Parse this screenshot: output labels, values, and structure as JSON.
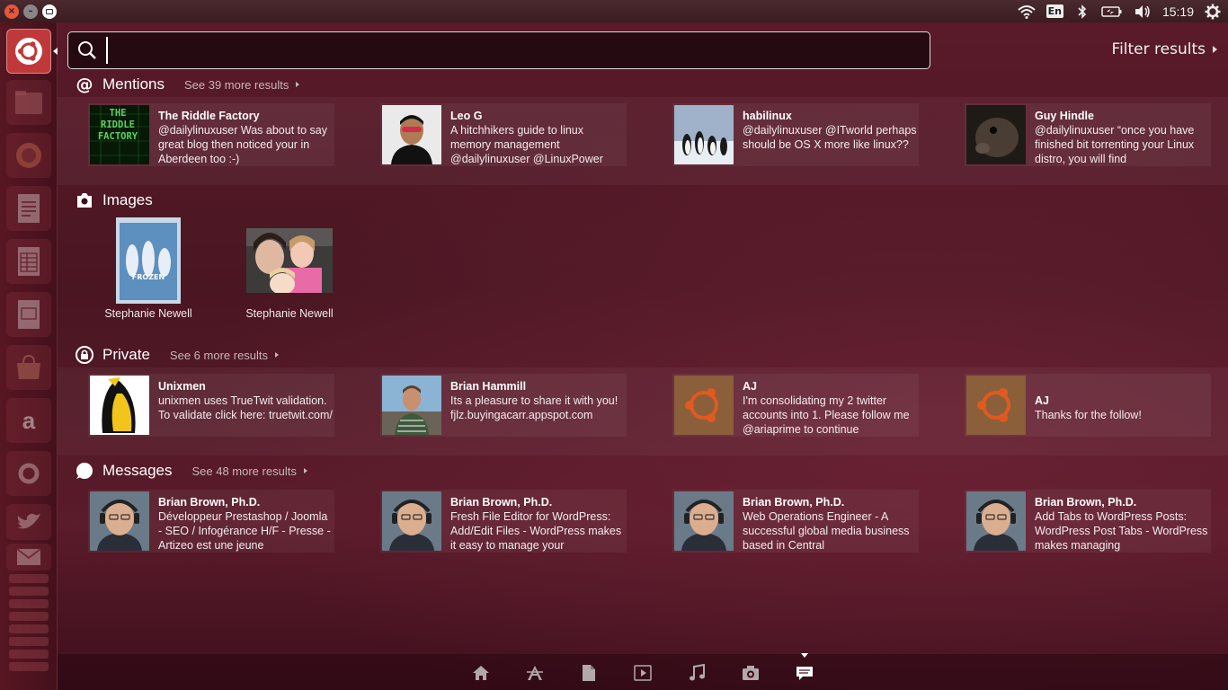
{
  "top_panel": {
    "keyboard_layout": "En",
    "clock": "15:19",
    "icons": [
      "close-icon",
      "minimize-icon",
      "maximize-icon",
      "wifi-icon",
      "bluetooth-icon",
      "battery-icon",
      "volume-icon",
      "gear-icon"
    ]
  },
  "search": {
    "value": "",
    "placeholder": ""
  },
  "filter": {
    "label": "Filter results"
  },
  "categories": {
    "mentions": {
      "title": "Mentions",
      "see_more": "See 39 more results",
      "results": [
        {
          "title": "The Riddle Factory",
          "text": "@dailylinuxuser Was about to say great blog then noticed your in Aberdeen too :-)",
          "thumb_text": "THE RIDDLE FACTORY"
        },
        {
          "title": "Leo G",
          "text": "A hitchhikers guide to linux memory management @dailylinuxuser @LinuxPower"
        },
        {
          "title": "habilinux",
          "text": "@dailylinuxuser @ITworld perhaps should be OS X more like linux??"
        },
        {
          "title": "Guy Hindle",
          "text": "@dailylinuxuser “once you have finished bit torrenting your Linux distro, you will find"
        }
      ]
    },
    "images": {
      "title": "Images",
      "results": [
        {
          "caption": "Stephanie Newell",
          "thumb_text": "FROZEN"
        },
        {
          "caption": "Stephanie Newell"
        }
      ]
    },
    "private": {
      "title": "Private",
      "see_more": "See 6 more results",
      "results": [
        {
          "title": "Unixmen",
          "text": "unixmen uses TrueTwit validation. To validate click here: truetwit.com/"
        },
        {
          "title": "Brian Hammill",
          "text": "Its a pleasure to share it with you! fjlz.buyingacarr.appspot.com"
        },
        {
          "title": "AJ",
          "text": "I'm consolidating my 2 twitter accounts into 1.  Please follow me @ariaprime to continue"
        },
        {
          "title": "AJ",
          "text": "Thanks for the follow!"
        }
      ]
    },
    "messages": {
      "title": "Messages",
      "see_more": "See 48 more results",
      "results": [
        {
          "title": "Brian Brown, Ph.D.",
          "text": "Développeur Prestashop / Joomla - SEO / Infogérance H/F - Presse - Artizeo est une jeune"
        },
        {
          "title": "Brian Brown, Ph.D.",
          "text": "Fresh File Editor for WordPress: Add/Edit Files -  WordPress makes it easy to manage your"
        },
        {
          "title": "Brian Brown, Ph.D.",
          "text": "Web Operations Engineer - A successful global media business based in Central"
        },
        {
          "title": "Brian Brown, Ph.D.",
          "text": "Add Tabs to WordPress Posts: WordPress Post Tabs - WordPress makes managing"
        }
      ]
    }
  },
  "launcher": {
    "items": [
      "ubuntu-dash-icon",
      "files-icon",
      "firefox-icon",
      "writer-icon",
      "calc-icon",
      "impress-icon",
      "software-center-icon",
      "amazon-icon",
      "settings-icon",
      "twitter-icon",
      "gmail-icon"
    ],
    "amazon_glyph": "a"
  },
  "lens_bar": {
    "lenses": [
      "home-lens-icon",
      "apps-lens-icon",
      "files-lens-icon",
      "video-lens-icon",
      "music-lens-icon",
      "photo-lens-icon",
      "social-lens-icon"
    ],
    "active": "social-lens-icon"
  },
  "colors": {
    "accent": "#c0393a",
    "background": "#4a1622",
    "close_button": "#e2583c"
  }
}
